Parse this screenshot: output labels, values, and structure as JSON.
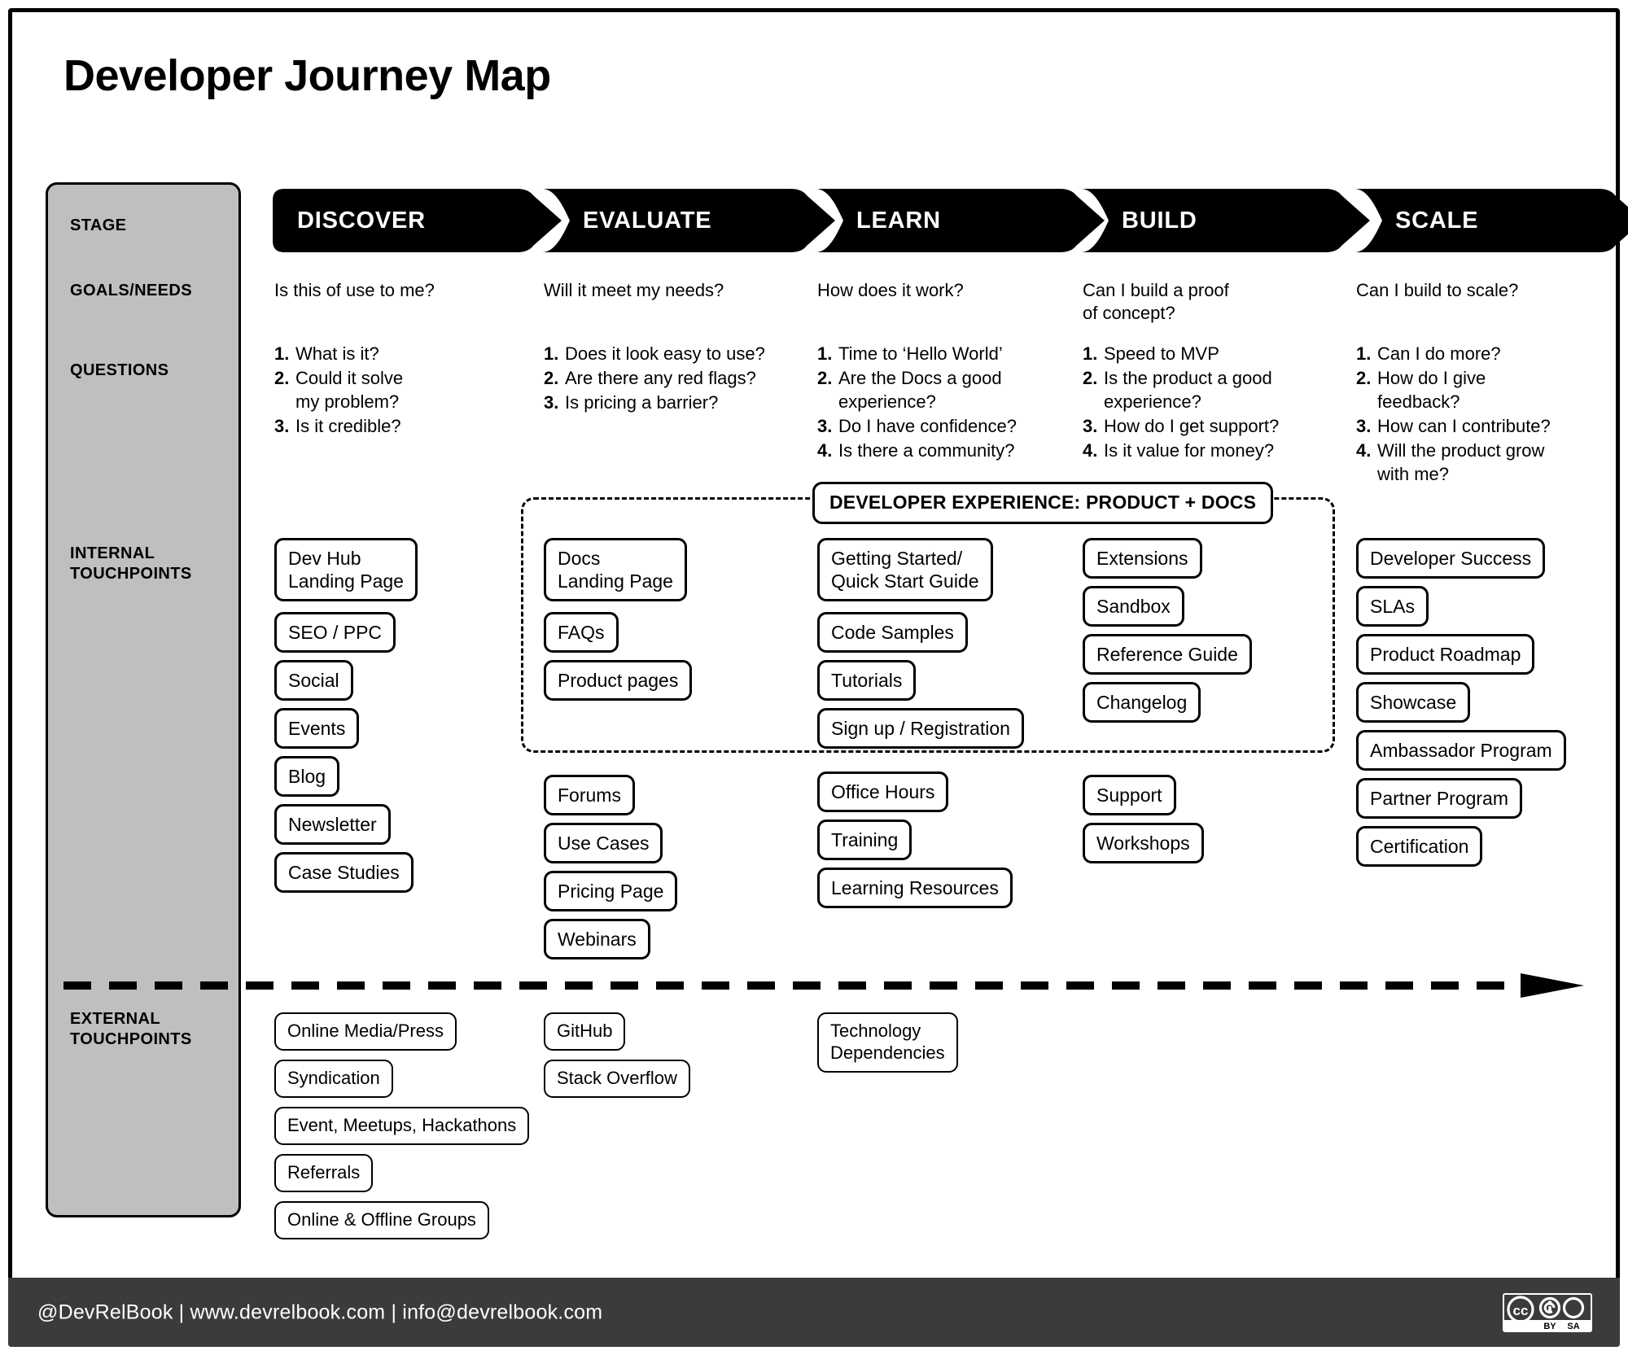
{
  "title": "Developer Journey Map",
  "sidebar": {
    "rows": [
      {
        "key": "stage",
        "label": "STAGE"
      },
      {
        "key": "goals",
        "label": "GOALS/NEEDS"
      },
      {
        "key": "questions",
        "label": "QUESTIONS"
      },
      {
        "key": "internal",
        "label": "INTERNAL\nTOUCHPOINTS"
      },
      {
        "key": "external",
        "label": "EXTERNAL\nTOUCHPOINTS"
      }
    ]
  },
  "dx_band": {
    "label": "DEVELOPER EXPERIENCE: PRODUCT + DOCS"
  },
  "stages": [
    {
      "id": "discover",
      "name": "DISCOVER",
      "goal": "Is this of use to me?",
      "questions": [
        {
          "num": "1.",
          "text": "What is it?"
        },
        {
          "num": "2.",
          "text": "Could it solve\nmy problem?"
        },
        {
          "num": "3.",
          "text": "Is it credible?"
        }
      ],
      "internal_dx": [],
      "internal_other": [
        "Dev Hub\nLanding Page",
        "SEO / PPC",
        "Social",
        "Events",
        "Blog",
        "Newsletter",
        "Case Studies"
      ],
      "external": [
        "Online Media/Press",
        "Syndication",
        "Event, Meetups, Hackathons",
        "Referrals",
        "Online & Offline Groups"
      ]
    },
    {
      "id": "evaluate",
      "name": "EVALUATE",
      "goal": "Will it meet my needs?",
      "questions": [
        {
          "num": "1.",
          "text": "Does it look easy to use?"
        },
        {
          "num": "2.",
          "text": "Are there any red flags?"
        },
        {
          "num": "3.",
          "text": "Is pricing a barrier?"
        }
      ],
      "internal_dx": [
        "Docs\nLanding Page",
        "FAQs",
        "Product pages"
      ],
      "internal_other": [
        "Forums",
        "Use Cases",
        "Pricing Page",
        "Webinars"
      ],
      "external": [
        "GitHub",
        "Stack Overflow"
      ]
    },
    {
      "id": "learn",
      "name": "LEARN",
      "goal": "How does it work?",
      "questions": [
        {
          "num": "1.",
          "text": "Time to ‘Hello World’"
        },
        {
          "num": "2.",
          "text": "Are the Docs a good\nexperience?"
        },
        {
          "num": "3.",
          "text": "Do I have confidence?"
        },
        {
          "num": "4.",
          "text": "Is there a community?"
        }
      ],
      "internal_dx": [
        "Getting Started/\nQuick Start Guide",
        "Code Samples",
        "Tutorials",
        "Sign up / Registration"
      ],
      "internal_other": [
        "Office Hours",
        "Training",
        "Learning Resources"
      ],
      "external": [
        "Technology\nDependencies"
      ]
    },
    {
      "id": "build",
      "name": "BUILD",
      "goal": "Can I build a proof\nof concept?",
      "questions": [
        {
          "num": "1.",
          "text": "Speed to MVP"
        },
        {
          "num": "2.",
          "text": "Is the product a good\nexperience?"
        },
        {
          "num": "3.",
          "text": "How do I get support?"
        },
        {
          "num": "4.",
          "text": "Is it value for money?"
        }
      ],
      "internal_dx": [
        "Extensions",
        "Sandbox",
        "Reference Guide",
        "Changelog"
      ],
      "internal_other": [
        "Support",
        "Workshops"
      ],
      "external": []
    },
    {
      "id": "scale",
      "name": "SCALE",
      "goal": "Can I build to scale?",
      "questions": [
        {
          "num": "1.",
          "text": "Can I do more?"
        },
        {
          "num": "2.",
          "text": "How do I give\nfeedback?"
        },
        {
          "num": "3.",
          "text": "How can I contribute?"
        },
        {
          "num": "4.",
          "text": "Will the product grow\nwith me?"
        }
      ],
      "internal_dx": [],
      "internal_other": [
        "Developer Success",
        "SLAs",
        "Product Roadmap",
        "Showcase",
        "Ambassador Program",
        "Partner Program",
        "Certification"
      ],
      "external": []
    }
  ],
  "footer": {
    "text": "@DevRelBook  |  www.devrelbook.com  |  info@devrelbook.com",
    "license": {
      "cc": "CC",
      "by": "BY",
      "sa": "SA"
    }
  },
  "colors": {
    "sidebar_fill": "#bfbfbf",
    "banner_fill": "#000000",
    "footer_fill": "#3b3b3b",
    "page_bg": "#ffffff"
  }
}
